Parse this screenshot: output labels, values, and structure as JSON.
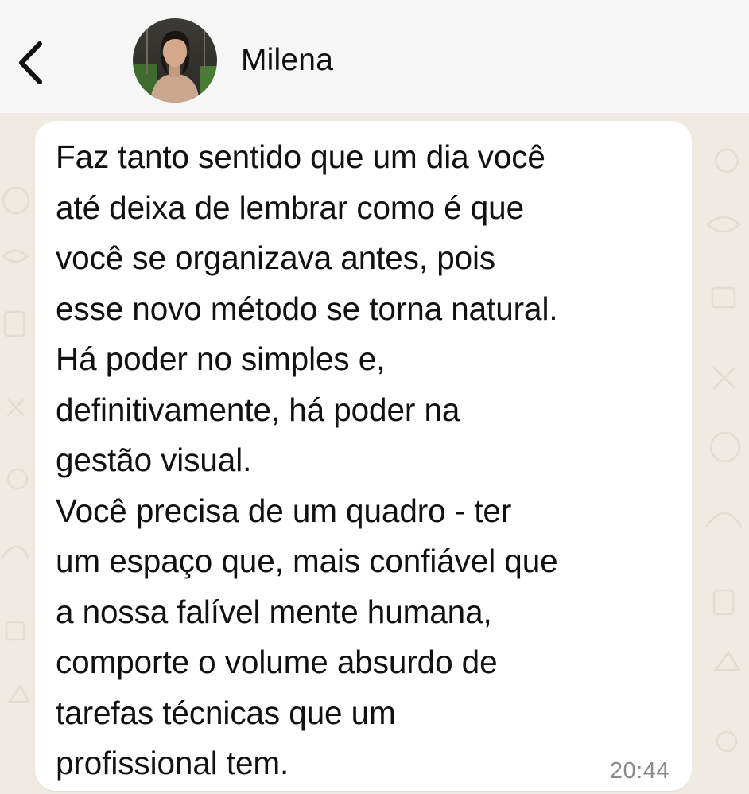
{
  "header": {
    "back_icon": "chevron-left-icon",
    "contact_name": "Milena",
    "avatar_icon": "profile-photo"
  },
  "message": {
    "text": "Faz tanto sentido que um dia você\naté deixa de lembrar como é que\nvocê se organizava antes, pois\nesse novo método se torna natural.\nHá poder no simples e,\ndefinitivamente, há poder na\ngestão visual.\nVocê precisa de um quadro - ter\num espaço que, mais confiável que\na nossa falível mente humana,\ncomporte o volume absurdo de\ntarefas técnicas que um\nprofissional tem.",
    "time": "20:44"
  },
  "colors": {
    "wallpaper": "#efeae2",
    "header_bg": "#f6f6f6",
    "bubble_bg": "#ffffff",
    "text": "#111111",
    "timestamp": "#8a8a8a"
  }
}
